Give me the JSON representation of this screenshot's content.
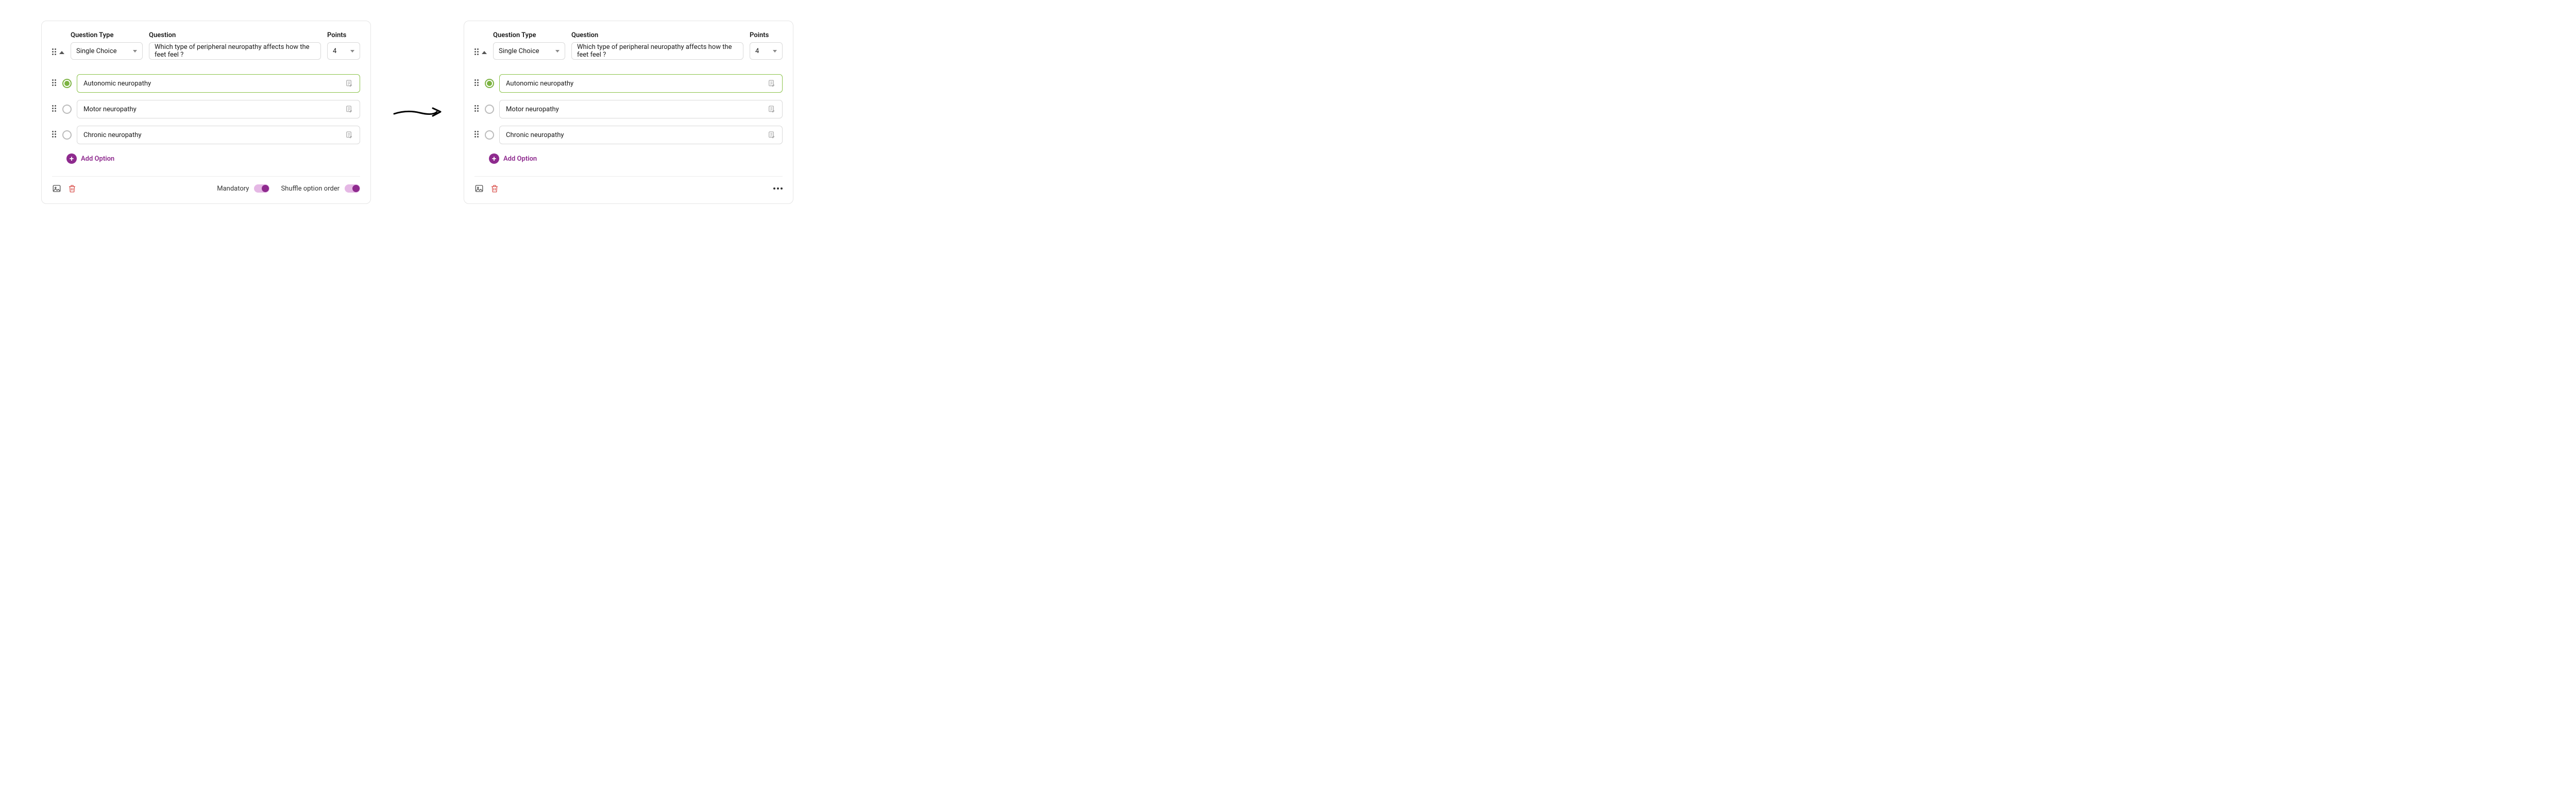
{
  "labels": {
    "question_type": "Question Type",
    "question": "Question",
    "points": "Points",
    "add_option": "Add Option",
    "mandatory": "Mandatory",
    "shuffle": "Shuffle option order"
  },
  "question": {
    "type_value": "Single Choice",
    "text": "Which type of peripheral neuropathy affects how the feet feel ?",
    "points": "4"
  },
  "options": [
    {
      "label": "Autonomic neuropathy",
      "correct": true
    },
    {
      "label": "Motor neuropathy",
      "correct": false
    },
    {
      "label": "Chronic neuropathy",
      "correct": false
    }
  ],
  "colors": {
    "accent_green": "#7cb342",
    "accent_purple": "#8e2a8e",
    "trash_red": "#d9534f"
  }
}
